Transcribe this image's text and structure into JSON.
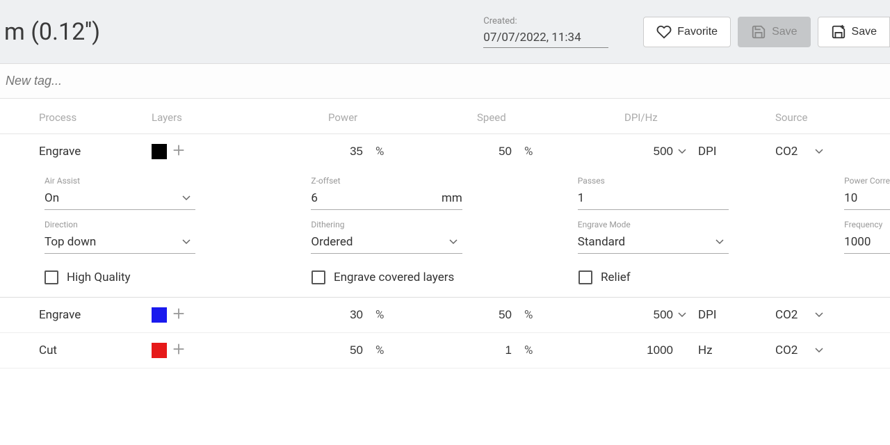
{
  "header": {
    "title": "m (0.12'')",
    "created_label": "Created:",
    "created_value": "07/07/2022, 11:34",
    "favorite": "Favorite",
    "save": "Save",
    "save_as": "Save"
  },
  "tag_placeholder": "New tag...",
  "columns": {
    "process": "Process",
    "layers": "Layers",
    "power": "Power",
    "speed": "Speed",
    "dpi": "DPI/Hz",
    "source": "Source"
  },
  "rows": [
    {
      "process": "Engrave",
      "color": "#000000",
      "power": "35",
      "speed": "50",
      "dpi_val": "500",
      "dpi_unit": "DPI",
      "has_chev": true,
      "source": "CO2"
    },
    {
      "process": "Engrave",
      "color": "#1a1aee",
      "power": "30",
      "speed": "50",
      "dpi_val": "500",
      "dpi_unit": "DPI",
      "has_chev": true,
      "source": "CO2"
    },
    {
      "process": "Cut",
      "color": "#e61919",
      "power": "50",
      "speed": "1",
      "dpi_val": "1000",
      "dpi_unit": "Hz",
      "has_chev": false,
      "source": "CO2"
    }
  ],
  "unit_pct": "%",
  "expanded": {
    "air_assist": {
      "label": "Air Assist",
      "value": "On"
    },
    "z_offset": {
      "label": "Z-offset",
      "value": "6",
      "unit": "mm"
    },
    "passes": {
      "label": "Passes",
      "value": "1"
    },
    "pow_corr": {
      "label": "Power Corre",
      "value": "10"
    },
    "direction": {
      "label": "Direction",
      "value": "Top down"
    },
    "dithering": {
      "label": "Dithering",
      "value": "Ordered"
    },
    "engrave_mode": {
      "label": "Engrave Mode",
      "value": "Standard"
    },
    "frequency": {
      "label": "Frequency",
      "value": "1000"
    },
    "high_quality": "High Quality",
    "covered": "Engrave covered layers",
    "relief": "Relief"
  }
}
